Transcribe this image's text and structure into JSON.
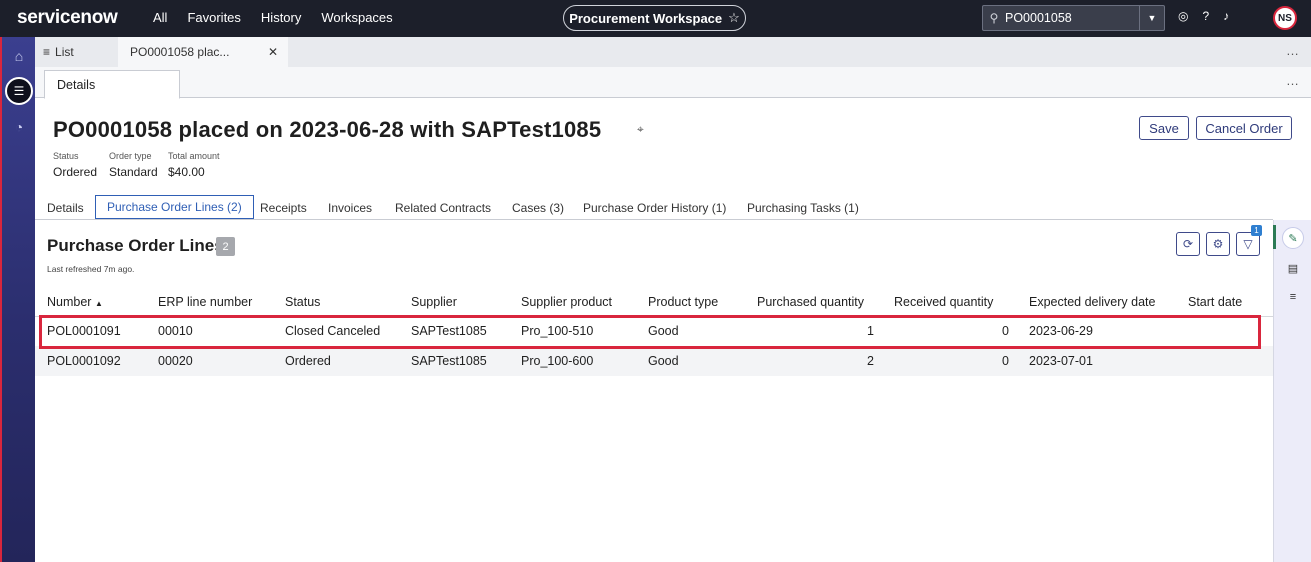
{
  "topbar": {
    "logo": "servicenow",
    "nav": [
      "All",
      "Favorites",
      "History",
      "Workspaces"
    ],
    "workspace": "Procurement Workspace",
    "search_value": "PO0001058",
    "avatar_initials": "NS"
  },
  "tabs": {
    "list_label": "List",
    "record_label": "PO0001058 plac..."
  },
  "detail_tab": "Details",
  "record": {
    "title": "PO0001058 placed on 2023-06-28 with SAPTest1085",
    "save_label": "Save",
    "cancel_label": "Cancel Order",
    "fields": {
      "status_label": "Status",
      "status_value": "Ordered",
      "order_type_label": "Order type",
      "order_type_value": "Standard",
      "total_label": "Total amount",
      "total_value": "$40.00"
    }
  },
  "subtabs": [
    "Details",
    "Purchase Order Lines (2)",
    "Receipts",
    "Invoices",
    "Related Contracts",
    "Cases (3)",
    "Purchase Order History (1)",
    "Purchasing Tasks (1)"
  ],
  "related_list": {
    "title": "Purchase Order Lines",
    "count": "2",
    "refreshed": "Last refreshed 7m ago.",
    "filter_badge": "1",
    "columns": [
      "Number",
      "ERP line number",
      "Status",
      "Supplier",
      "Supplier product",
      "Product type",
      "Purchased quantity",
      "Received quantity",
      "Expected delivery date",
      "Start date"
    ],
    "sort_indicator": "▲",
    "rows": [
      {
        "number": "POL0001091",
        "erp": "00010",
        "status": "Closed Canceled",
        "supplier": "SAPTest1085",
        "product": "Pro_100-510",
        "type": "Good",
        "purchased": "1",
        "received": "0",
        "delivery": "2023-06-29",
        "start": ""
      },
      {
        "number": "POL0001092",
        "erp": "00020",
        "status": "Ordered",
        "supplier": "SAPTest1085",
        "product": "Pro_100-600",
        "type": "Good",
        "purchased": "2",
        "received": "0",
        "delivery": "2023-07-01",
        "start": ""
      }
    ]
  },
  "colors": {
    "topbar": "#1c1f2a",
    "accent": "#3f4a8a",
    "link": "#3a5cc7",
    "highlight": "#d9263d"
  }
}
